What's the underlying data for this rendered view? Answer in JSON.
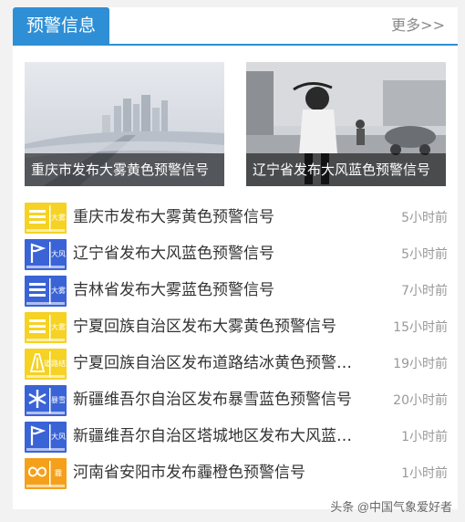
{
  "header": {
    "title": "预警信息",
    "more": "更多>>",
    "accent_color": "#2f8fd6"
  },
  "featured": [
    {
      "caption": "重庆市发布大雾黄色预警信号",
      "image": "foggy-city-photo"
    },
    {
      "caption": "辽宁省发布大风蓝色预警信号",
      "image": "windy-street-photo"
    }
  ],
  "alerts": [
    {
      "title": "重庆市发布大雾黄色预警信号",
      "time": "5小时前",
      "icon": "fog-yellow-icon",
      "color": "#f5d223",
      "hazard": "大雾"
    },
    {
      "title": "辽宁省发布大风蓝色预警信号",
      "time": "5小时前",
      "icon": "gale-blue-icon",
      "color": "#3a63d6",
      "hazard": "大风"
    },
    {
      "title": "吉林省发布大雾蓝色预警信号",
      "time": "7小时前",
      "icon": "fog-blue-icon",
      "color": "#3a63d6",
      "hazard": "大雾"
    },
    {
      "title": "宁夏回族自治区发布大雾黄色预警信号",
      "time": "15小时前",
      "icon": "fog-yellow-icon",
      "color": "#f5d223",
      "hazard": "大雾"
    },
    {
      "title": "宁夏回族自治区发布道路结冰黄色预警信号",
      "time": "19小时前",
      "icon": "road-icing-yellow-icon",
      "color": "#f5d223",
      "hazard": "道路结冰"
    },
    {
      "title": "新疆维吾尔自治区发布暴雪蓝色预警信号",
      "time": "20小时前",
      "icon": "snowstorm-blue-icon",
      "color": "#3a63d6",
      "hazard": "暴雪"
    },
    {
      "title": "新疆维吾尔自治区塔城地区发布大风蓝色预警信号",
      "time": "1小时前",
      "icon": "gale-blue-icon",
      "color": "#3a63d6",
      "hazard": "大风"
    },
    {
      "title": "河南省安阳市发布霾橙色预警信号",
      "time": "1小时前",
      "icon": "haze-orange-icon",
      "color": "#f5a01a",
      "hazard": "霾"
    }
  ],
  "watermark": "头条 @中国气象爱好者"
}
